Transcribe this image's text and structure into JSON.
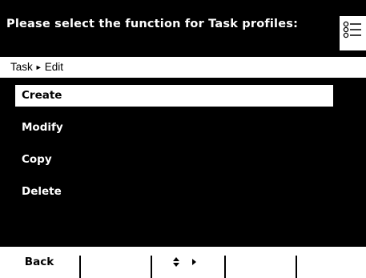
{
  "header": {
    "title": "Please select the function for Task profiles:",
    "icon": "list-icon"
  },
  "breadcrumb": {
    "parent": "Task",
    "separator": "►",
    "current": "Edit"
  },
  "menu": {
    "items": [
      {
        "label": "Create",
        "selected": true
      },
      {
        "label": "Modify",
        "selected": false
      },
      {
        "label": "Copy",
        "selected": false
      },
      {
        "label": "Delete",
        "selected": false
      }
    ]
  },
  "softkeys": {
    "back_label": "Back",
    "slot2_label": "",
    "nav_icon": "up-down-right-arrows-icon",
    "slot4_label": "",
    "slot5_label": ""
  },
  "colors": {
    "background": "#000000",
    "foreground": "#ffffff",
    "highlight": "#ffffff"
  }
}
